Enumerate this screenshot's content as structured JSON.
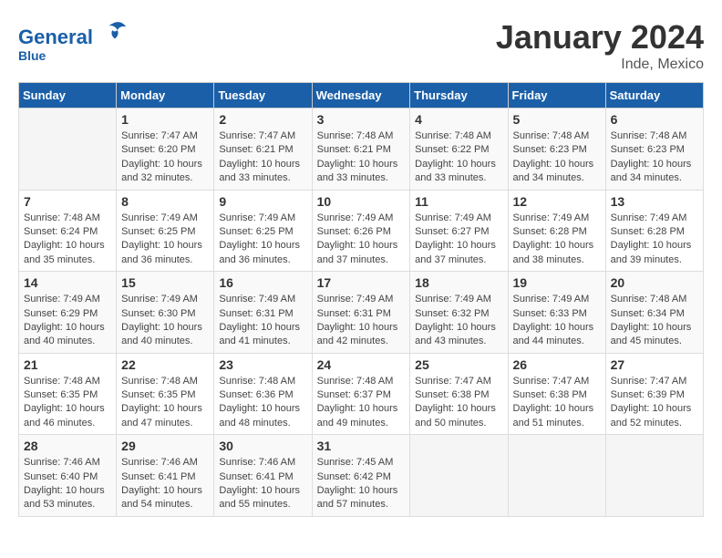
{
  "header": {
    "logo_line1": "General",
    "logo_line2": "Blue",
    "month": "January 2024",
    "location": "Inde, Mexico"
  },
  "weekdays": [
    "Sunday",
    "Monday",
    "Tuesday",
    "Wednesday",
    "Thursday",
    "Friday",
    "Saturday"
  ],
  "weeks": [
    [
      {
        "day": "",
        "sunrise": "",
        "sunset": "",
        "daylight": ""
      },
      {
        "day": "1",
        "sunrise": "Sunrise: 7:47 AM",
        "sunset": "Sunset: 6:20 PM",
        "daylight": "Daylight: 10 hours and 32 minutes."
      },
      {
        "day": "2",
        "sunrise": "Sunrise: 7:47 AM",
        "sunset": "Sunset: 6:21 PM",
        "daylight": "Daylight: 10 hours and 33 minutes."
      },
      {
        "day": "3",
        "sunrise": "Sunrise: 7:48 AM",
        "sunset": "Sunset: 6:21 PM",
        "daylight": "Daylight: 10 hours and 33 minutes."
      },
      {
        "day": "4",
        "sunrise": "Sunrise: 7:48 AM",
        "sunset": "Sunset: 6:22 PM",
        "daylight": "Daylight: 10 hours and 33 minutes."
      },
      {
        "day": "5",
        "sunrise": "Sunrise: 7:48 AM",
        "sunset": "Sunset: 6:23 PM",
        "daylight": "Daylight: 10 hours and 34 minutes."
      },
      {
        "day": "6",
        "sunrise": "Sunrise: 7:48 AM",
        "sunset": "Sunset: 6:23 PM",
        "daylight": "Daylight: 10 hours and 34 minutes."
      }
    ],
    [
      {
        "day": "7",
        "sunrise": "Sunrise: 7:48 AM",
        "sunset": "Sunset: 6:24 PM",
        "daylight": "Daylight: 10 hours and 35 minutes."
      },
      {
        "day": "8",
        "sunrise": "Sunrise: 7:49 AM",
        "sunset": "Sunset: 6:25 PM",
        "daylight": "Daylight: 10 hours and 36 minutes."
      },
      {
        "day": "9",
        "sunrise": "Sunrise: 7:49 AM",
        "sunset": "Sunset: 6:25 PM",
        "daylight": "Daylight: 10 hours and 36 minutes."
      },
      {
        "day": "10",
        "sunrise": "Sunrise: 7:49 AM",
        "sunset": "Sunset: 6:26 PM",
        "daylight": "Daylight: 10 hours and 37 minutes."
      },
      {
        "day": "11",
        "sunrise": "Sunrise: 7:49 AM",
        "sunset": "Sunset: 6:27 PM",
        "daylight": "Daylight: 10 hours and 37 minutes."
      },
      {
        "day": "12",
        "sunrise": "Sunrise: 7:49 AM",
        "sunset": "Sunset: 6:28 PM",
        "daylight": "Daylight: 10 hours and 38 minutes."
      },
      {
        "day": "13",
        "sunrise": "Sunrise: 7:49 AM",
        "sunset": "Sunset: 6:28 PM",
        "daylight": "Daylight: 10 hours and 39 minutes."
      }
    ],
    [
      {
        "day": "14",
        "sunrise": "Sunrise: 7:49 AM",
        "sunset": "Sunset: 6:29 PM",
        "daylight": "Daylight: 10 hours and 40 minutes."
      },
      {
        "day": "15",
        "sunrise": "Sunrise: 7:49 AM",
        "sunset": "Sunset: 6:30 PM",
        "daylight": "Daylight: 10 hours and 40 minutes."
      },
      {
        "day": "16",
        "sunrise": "Sunrise: 7:49 AM",
        "sunset": "Sunset: 6:31 PM",
        "daylight": "Daylight: 10 hours and 41 minutes."
      },
      {
        "day": "17",
        "sunrise": "Sunrise: 7:49 AM",
        "sunset": "Sunset: 6:31 PM",
        "daylight": "Daylight: 10 hours and 42 minutes."
      },
      {
        "day": "18",
        "sunrise": "Sunrise: 7:49 AM",
        "sunset": "Sunset: 6:32 PM",
        "daylight": "Daylight: 10 hours and 43 minutes."
      },
      {
        "day": "19",
        "sunrise": "Sunrise: 7:49 AM",
        "sunset": "Sunset: 6:33 PM",
        "daylight": "Daylight: 10 hours and 44 minutes."
      },
      {
        "day": "20",
        "sunrise": "Sunrise: 7:48 AM",
        "sunset": "Sunset: 6:34 PM",
        "daylight": "Daylight: 10 hours and 45 minutes."
      }
    ],
    [
      {
        "day": "21",
        "sunrise": "Sunrise: 7:48 AM",
        "sunset": "Sunset: 6:35 PM",
        "daylight": "Daylight: 10 hours and 46 minutes."
      },
      {
        "day": "22",
        "sunrise": "Sunrise: 7:48 AM",
        "sunset": "Sunset: 6:35 PM",
        "daylight": "Daylight: 10 hours and 47 minutes."
      },
      {
        "day": "23",
        "sunrise": "Sunrise: 7:48 AM",
        "sunset": "Sunset: 6:36 PM",
        "daylight": "Daylight: 10 hours and 48 minutes."
      },
      {
        "day": "24",
        "sunrise": "Sunrise: 7:48 AM",
        "sunset": "Sunset: 6:37 PM",
        "daylight": "Daylight: 10 hours and 49 minutes."
      },
      {
        "day": "25",
        "sunrise": "Sunrise: 7:47 AM",
        "sunset": "Sunset: 6:38 PM",
        "daylight": "Daylight: 10 hours and 50 minutes."
      },
      {
        "day": "26",
        "sunrise": "Sunrise: 7:47 AM",
        "sunset": "Sunset: 6:38 PM",
        "daylight": "Daylight: 10 hours and 51 minutes."
      },
      {
        "day": "27",
        "sunrise": "Sunrise: 7:47 AM",
        "sunset": "Sunset: 6:39 PM",
        "daylight": "Daylight: 10 hours and 52 minutes."
      }
    ],
    [
      {
        "day": "28",
        "sunrise": "Sunrise: 7:46 AM",
        "sunset": "Sunset: 6:40 PM",
        "daylight": "Daylight: 10 hours and 53 minutes."
      },
      {
        "day": "29",
        "sunrise": "Sunrise: 7:46 AM",
        "sunset": "Sunset: 6:41 PM",
        "daylight": "Daylight: 10 hours and 54 minutes."
      },
      {
        "day": "30",
        "sunrise": "Sunrise: 7:46 AM",
        "sunset": "Sunset: 6:41 PM",
        "daylight": "Daylight: 10 hours and 55 minutes."
      },
      {
        "day": "31",
        "sunrise": "Sunrise: 7:45 AM",
        "sunset": "Sunset: 6:42 PM",
        "daylight": "Daylight: 10 hours and 57 minutes."
      },
      {
        "day": "",
        "sunrise": "",
        "sunset": "",
        "daylight": ""
      },
      {
        "day": "",
        "sunrise": "",
        "sunset": "",
        "daylight": ""
      },
      {
        "day": "",
        "sunrise": "",
        "sunset": "",
        "daylight": ""
      }
    ]
  ]
}
